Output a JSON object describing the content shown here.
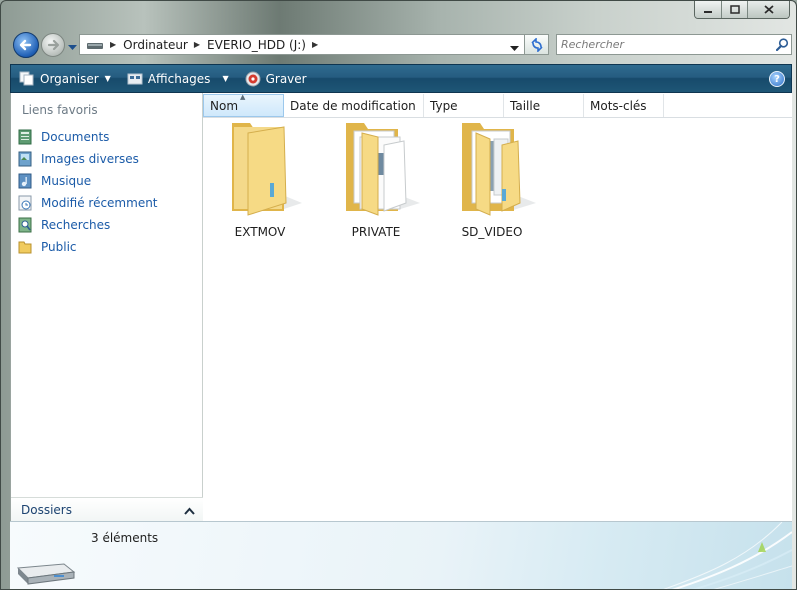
{
  "window": {
    "caption_buttons": [
      "minimize",
      "maximize",
      "close"
    ]
  },
  "address": {
    "crumbs": [
      "Ordinateur",
      "EVERIO_HDD (J:)"
    ],
    "drive_icon": "drive-icon"
  },
  "search": {
    "placeholder": "Rechercher"
  },
  "toolbar": {
    "organiser": "Organiser",
    "affichages": "Affichages",
    "graver": "Graver"
  },
  "favorites": {
    "title": "Liens favoris",
    "items": [
      {
        "label": "Documents",
        "icon": "documents-icon"
      },
      {
        "label": "Images diverses",
        "icon": "images-icon"
      },
      {
        "label": "Musique",
        "icon": "music-icon"
      },
      {
        "label": "Modifié récemment",
        "icon": "recent-icon"
      },
      {
        "label": "Recherches",
        "icon": "searches-icon"
      },
      {
        "label": "Public",
        "icon": "public-folder-icon"
      }
    ],
    "dossiers": "Dossiers"
  },
  "columns": [
    "Nom",
    "Date de modification",
    "Type",
    "Taille",
    "Mots-clés"
  ],
  "files": [
    {
      "name": "EXTMOV",
      "icon": "empty-folder-icon"
    },
    {
      "name": "PRIVATE",
      "icon": "documents-folder-icon"
    },
    {
      "name": "SD_VIDEO",
      "icon": "full-folder-icon"
    }
  ],
  "status": {
    "count": "3 éléments"
  },
  "colors": {
    "toolbar": "#255c80",
    "link": "#1b5ba8",
    "folder": "#f2d37a"
  }
}
